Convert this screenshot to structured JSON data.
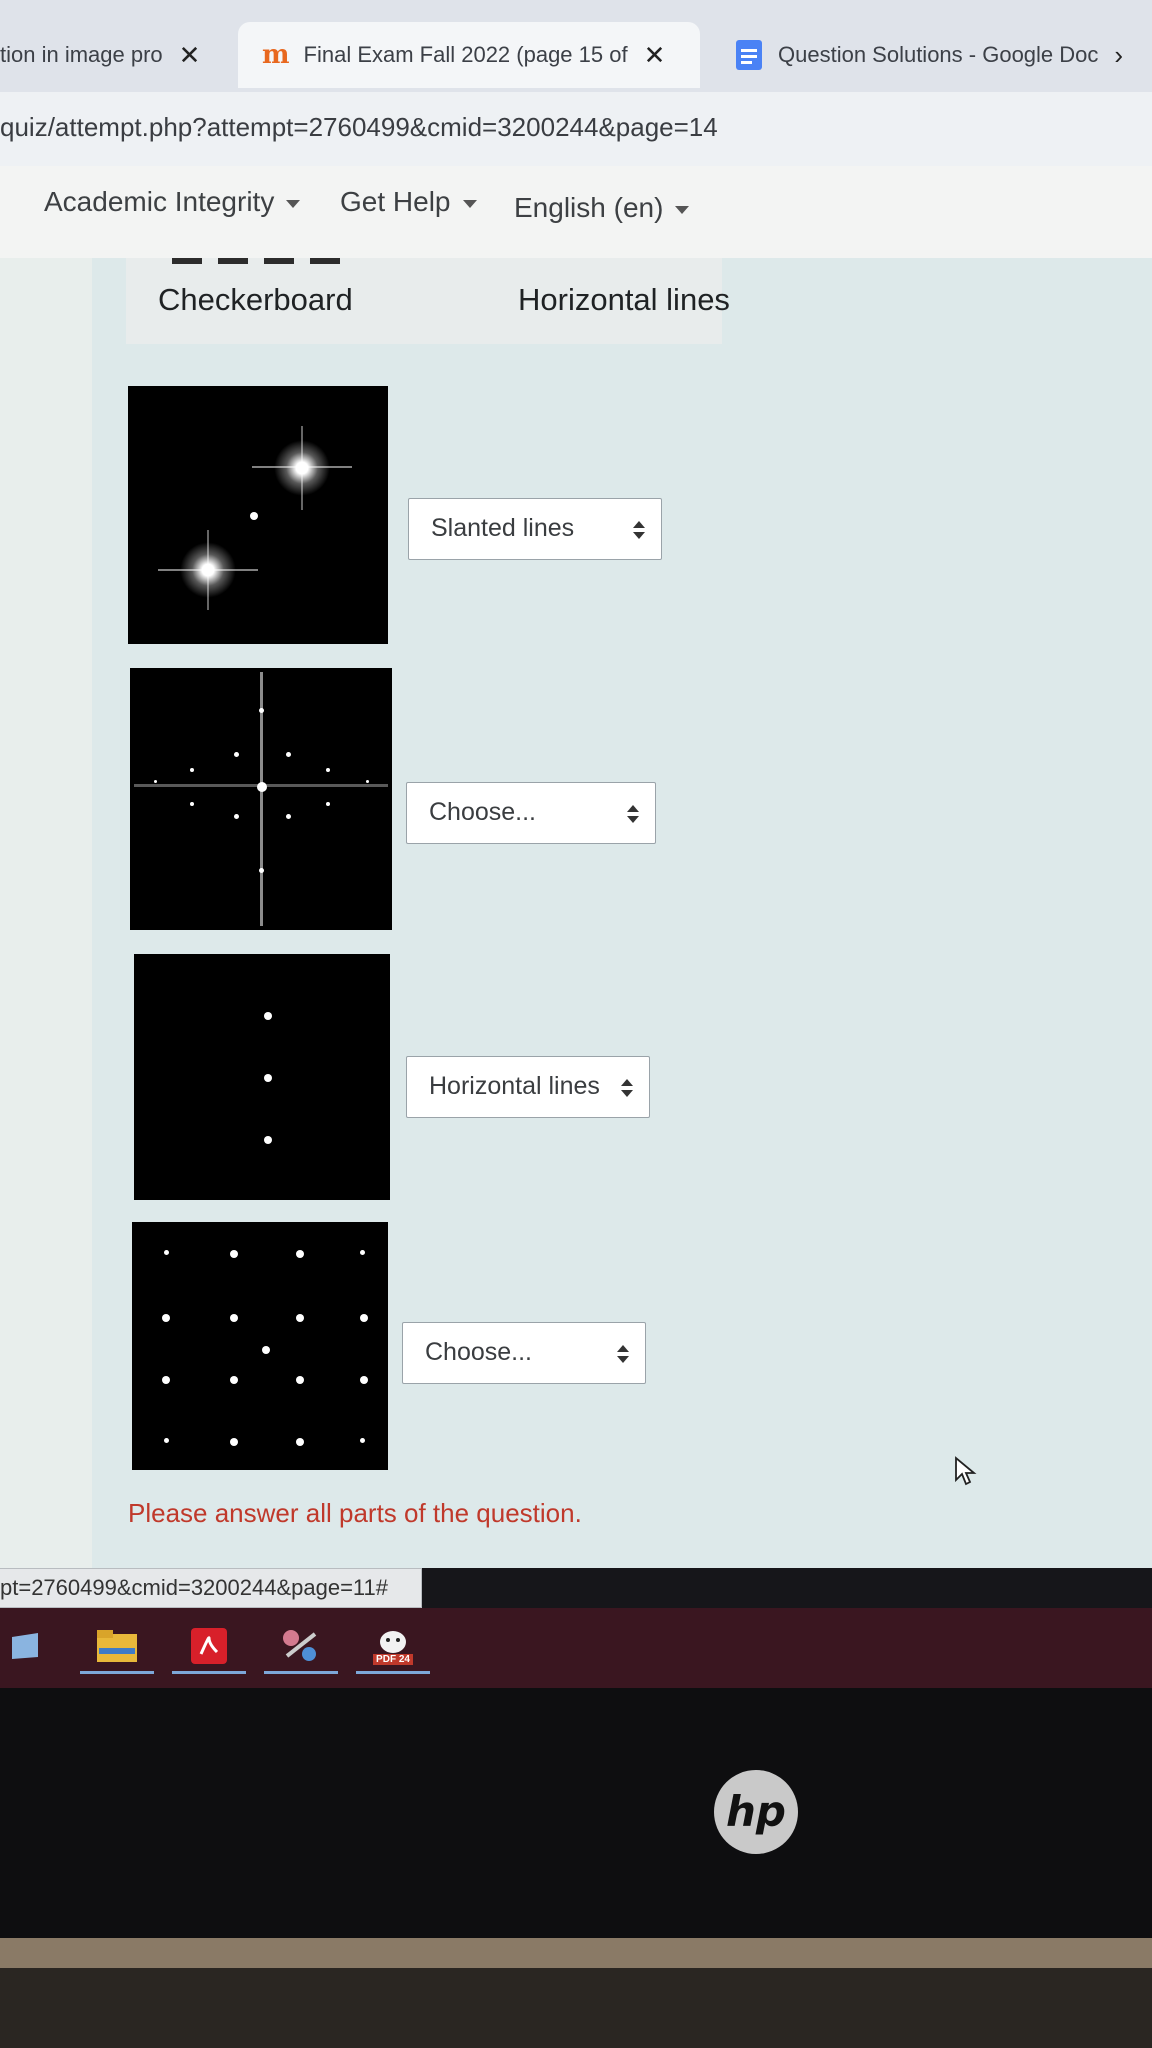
{
  "browser": {
    "tabs": [
      {
        "title": "tion in image pro",
        "close": "✕",
        "active": false
      },
      {
        "title": "Final Exam Fall 2022 (page 15 of",
        "close": "✕",
        "active": true
      },
      {
        "title": "Question Solutions - Google Doc",
        "close": "›",
        "active": false
      }
    ],
    "url": "quiz/attempt.php?attempt=2760499&cmid=3200244&page=14"
  },
  "navbar": {
    "items": [
      "Academic Integrity",
      "Get Help",
      "English (en)"
    ]
  },
  "answers": {
    "header_options": [
      "Checkerboard",
      "Horizontal lines"
    ]
  },
  "questions": [
    {
      "image": "two diagonal bright points spectrum",
      "selected": "Slanted lines"
    },
    {
      "image": "cross-shaped scattered spectrum",
      "selected": "Choose..."
    },
    {
      "image": "three vertical points spectrum",
      "selected": "Horizontal lines"
    },
    {
      "image": "grid of points spectrum",
      "selected": "Choose..."
    }
  ],
  "error_message": "Please answer all parts of the question.",
  "status_url": "pt=2760499&cmid=3200244&page=11#",
  "taskbar": {
    "icons": [
      "file-explorer-icon",
      "acrobat-icon",
      "snipping-tool-icon",
      "pdf-24-icon"
    ],
    "pdf_label": "PDF 24"
  },
  "laptop": {
    "logo": "hp"
  },
  "colors": {
    "error": "#c0392b",
    "taskbar": "#3a1620",
    "moodle_accent": "#e8681f",
    "gdocs_blue": "#4a82f5"
  }
}
